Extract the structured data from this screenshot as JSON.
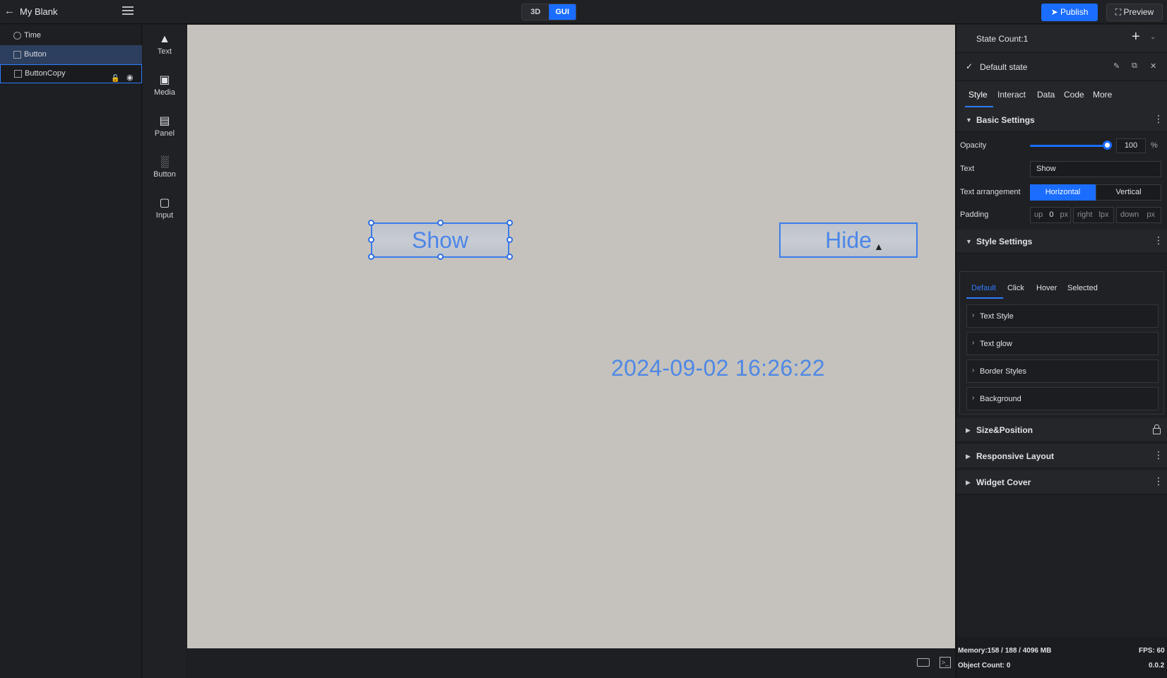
{
  "topbar": {
    "back_icon": "arrow-left-icon",
    "project_title": "My Blank",
    "menu_icon": "hamburger-icon",
    "mode_3d": "3D",
    "mode_gui": "GUI",
    "active_mode": "GUI",
    "publish_label": "Publish",
    "publish_icon": "send-icon",
    "preview_label": "Preview",
    "preview_icon": "expand-icon",
    "accent_color": "#1a6dff"
  },
  "layers": [
    {
      "label": "Time",
      "icon": "clock-icon",
      "state": "normal"
    },
    {
      "label": "Button",
      "icon": "button-widget-icon",
      "state": "selected"
    },
    {
      "label": "ButtonCopy",
      "icon": "button-widget-icon",
      "state": "outlined",
      "lock_icon": "unlock-icon",
      "eye_icon": "eye-icon"
    }
  ],
  "widgets": [
    {
      "label": "Text",
      "icon": "text-widget-icon"
    },
    {
      "label": "Media",
      "icon": "media-widget-icon"
    },
    {
      "label": "Panel",
      "icon": "panel-widget-icon"
    },
    {
      "label": "Button",
      "icon": "chart-widget-icon"
    },
    {
      "label": "Input",
      "icon": "input-widget-icon"
    }
  ],
  "canvas": {
    "show_button": "Show",
    "hide_button": "Hide",
    "time_text": "2024-09-02 16:26:22",
    "background_color": "#c5c2bd",
    "text_color": "#4f88e4"
  },
  "panel": {
    "state_count": "State Count:1",
    "default_state": "Default state",
    "tabs": [
      "Style",
      "Interact",
      "Data",
      "Code",
      "More"
    ],
    "active_tab": "Style",
    "basic_settings": "Basic Settings",
    "opacity_label": "Opacity",
    "opacity_value": "100",
    "opacity_unit": "%",
    "text_label": "Text",
    "text_value": "Show",
    "arrangement_label": "Text arrangement",
    "arrangement_horizontal": "Horizontal",
    "arrangement_vertical": "Vertical",
    "padding_label": "Padding",
    "padding": {
      "up_label": "up",
      "up_value": "0",
      "up_unit": "px",
      "right_label": "right",
      "right_unit": "lpx",
      "down_label": "down",
      "down_unit": "px"
    },
    "style_settings": "Style Settings",
    "style_tabs": [
      "Default",
      "Click",
      "Hover",
      "Selected"
    ],
    "active_style_tab": "Default",
    "style_groups": [
      "Text Style",
      "Text glow",
      "Border Styles",
      "Background"
    ],
    "size_position": "Size&Position",
    "responsive_layout": "Responsive Layout",
    "widget_cover": "Widget Cover"
  },
  "footer": {
    "memory": "Memory:158 / 188 / 4096 MB",
    "fps": "FPS: 60",
    "object_count": "Object Count: 0",
    "version": "0.0.2"
  }
}
